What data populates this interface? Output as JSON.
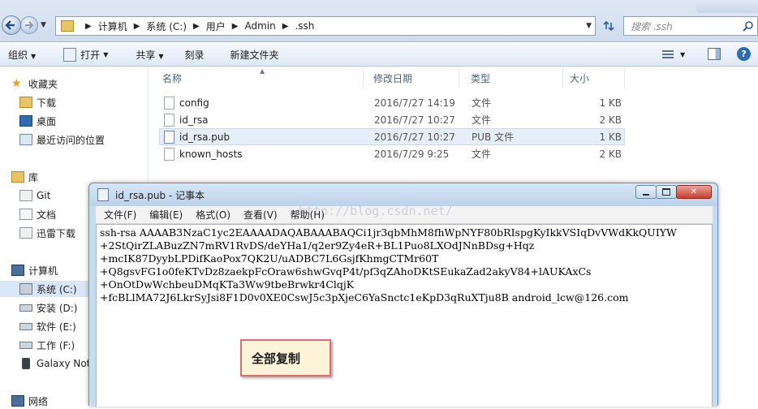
{
  "explorer": {
    "breadcrumb": [
      "计算机",
      "系统 (C:)",
      "用户",
      "Admin",
      ".ssh"
    ],
    "search_placeholder": "搜索 .ssh",
    "toolbar": {
      "organize": "组织",
      "open": "打开",
      "share": "共享",
      "burn": "刻录",
      "new_folder": "新建文件夹"
    },
    "nav": {
      "favorites": "收藏夹",
      "downloads": "下载",
      "desktop": "桌面",
      "recent": "最近访问的位置",
      "libraries": "库",
      "git": "Git",
      "documents": "文档",
      "thunder": "迅雷下载",
      "computer": "计算机",
      "drive_c": "系统 (C:)",
      "drive_d": "安装 (D:)",
      "drive_e": "软件 (E:)",
      "drive_f": "工作 (F:)",
      "galaxy": "Galaxy Not",
      "network": "网络"
    },
    "columns": {
      "name": "名称",
      "modified": "修改日期",
      "type": "类型",
      "size": "大小"
    },
    "files": [
      {
        "name": "config",
        "modified": "2016/7/27 14:19",
        "type": "文件",
        "size": "1 KB"
      },
      {
        "name": "id_rsa",
        "modified": "2016/7/27 10:27",
        "type": "文件",
        "size": "2 KB"
      },
      {
        "name": "id_rsa.pub",
        "modified": "2016/7/27 10:27",
        "type": "PUB 文件",
        "size": "1 KB"
      },
      {
        "name": "known_hosts",
        "modified": "2016/7/29 9:25",
        "type": "文件",
        "size": "2 KB"
      }
    ]
  },
  "notepad": {
    "title": "id_rsa.pub - 记事本",
    "menu": {
      "file": "文件(F)",
      "edit": "编辑(E)",
      "format": "格式(O)",
      "view": "查看(V)",
      "help": "帮助(H)"
    },
    "content": [
      "ssh-rsa AAAAB3NzaC1yc2EAAAADAQABAAABAQCi1jr3qbMhM8fhWpNYF80bRIspgKyIkkVSIqDvVWdKkQUIYW",
      "+2StQirZLABuzZN7mRV1RvDS/deYHa1/q2er9Zy4eR+BL1Puo8LXOdJNnBDsg+Hqz",
      "+mcIK87DyybLPDifKaoPox7QK2U/uADBC7L6GsjfKhmgCTMr60T",
      "+Q8gsvFG1o0feKTvDz8zaekpFcOraw6shwGvqP4t/pf3qZAhoDKtSEukaZad2akyV84+lAUKAxCs",
      "+OnOtDwWchbeuDMqKTa3Ww9tbeBrwkr4ClqjK",
      "+fcBLlMA72J6LkrSyJsi8F1D0v0XE0CswJ5c3pXjeC6YaSnctc1eKpD3qRuXTju8B android_lcw@126.com"
    ]
  },
  "watermark": "http://blog.csdn.net/",
  "callout": "全部复制"
}
